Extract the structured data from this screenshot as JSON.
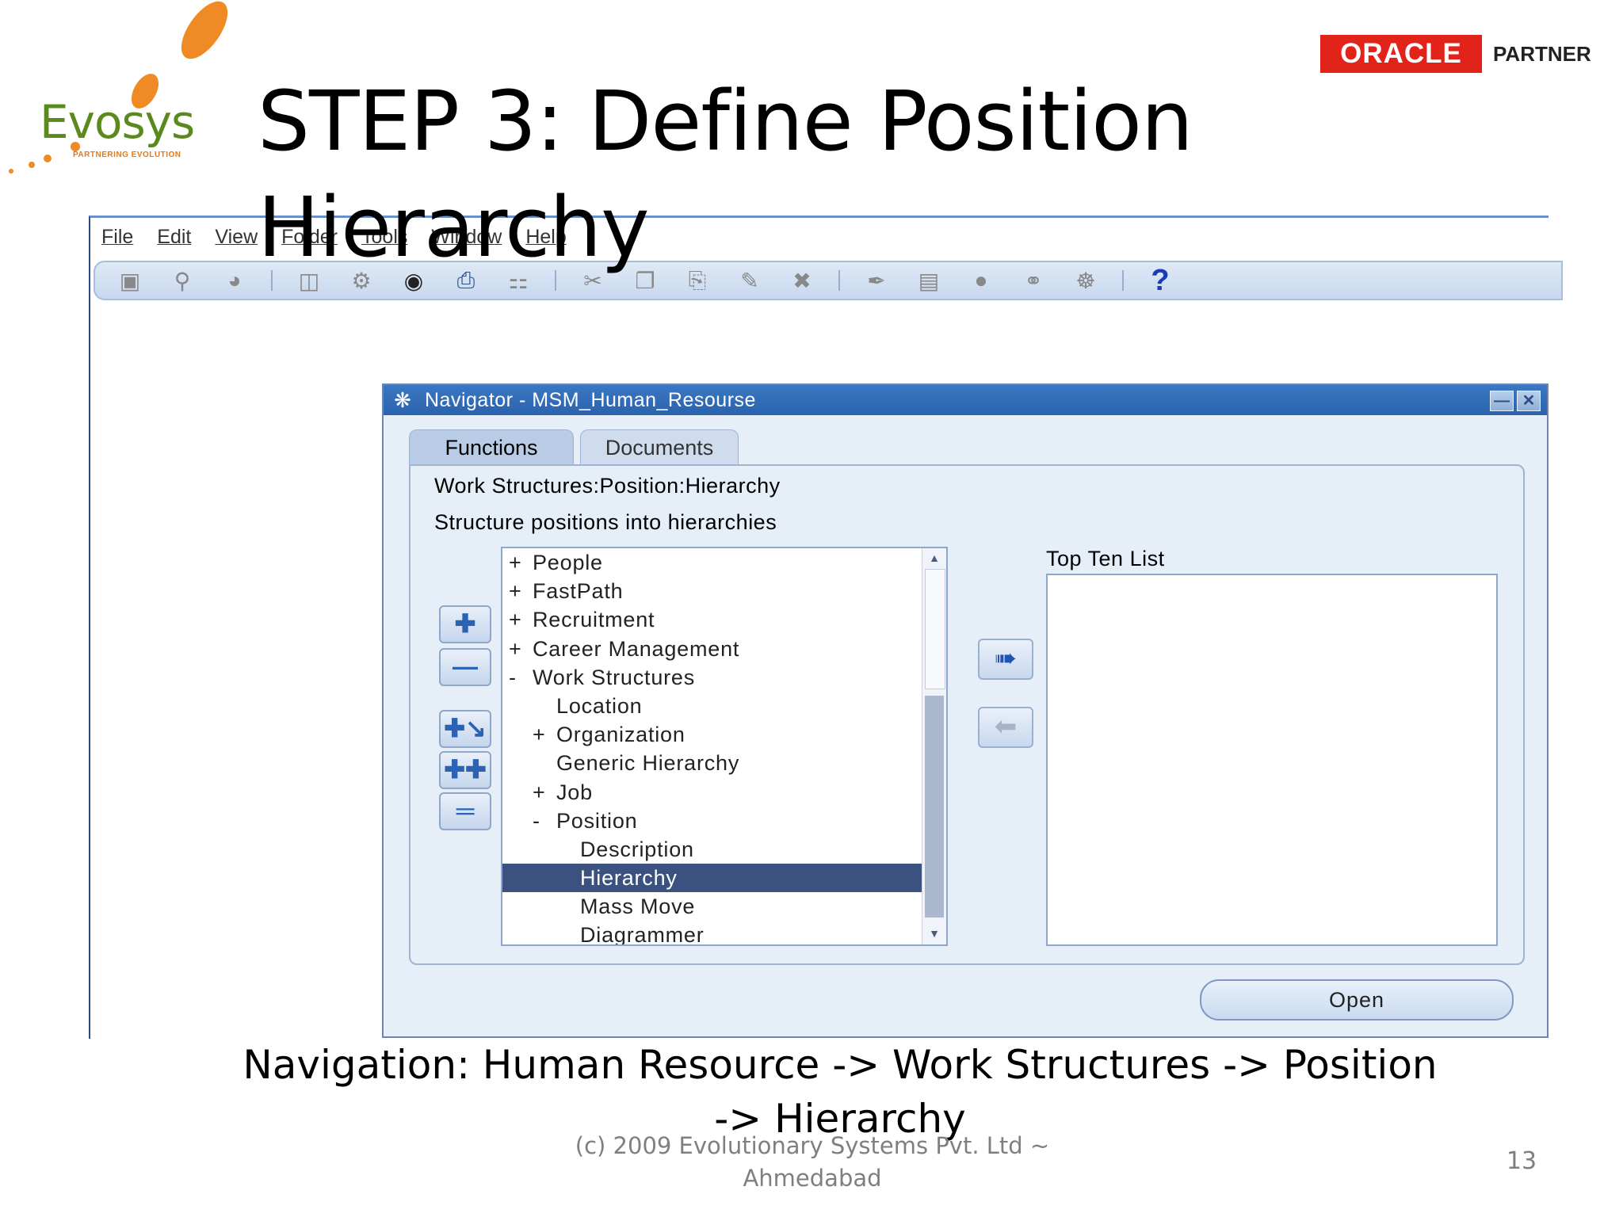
{
  "slide": {
    "title": "STEP 3: Define Position Hierarchy",
    "navigation_caption": "Navigation: Human Resource -> Work Structures -> Position -> Hierarchy",
    "footer": "(c) 2009 Evolutionary Systems Pvt. Ltd ~ Ahmedabad",
    "page_number": "13"
  },
  "logo": {
    "name": "Evosys",
    "tagline": "PARTNERING EVOLUTION"
  },
  "oracle_badge": {
    "brand": "ORACLE",
    "label": "PARTNER",
    "color": "#e2231a"
  },
  "app": {
    "menu": [
      "File",
      "Edit",
      "View",
      "Folder",
      "Tools",
      "Window",
      "Help"
    ],
    "toolbar_icons": [
      "new-record-icon",
      "find-icon",
      "navigator-icon",
      "save-icon",
      "next-step-icon",
      "switch-responsibility-icon",
      "print-icon",
      "close-form-icon",
      "cut-icon",
      "copy-icon",
      "paste-icon",
      "clear-record-icon",
      "delete-record-icon",
      "edit-field-icon",
      "zoom-icon",
      "translations-icon",
      "attachments-icon",
      "folder-tools-icon",
      "help-icon"
    ],
    "help_glyph": "?"
  },
  "navigator": {
    "title": "Navigator - MSM_Human_Resourse",
    "tabs": {
      "functions": "Functions",
      "documents": "Documents"
    },
    "selected_path": "Work Structures:Position:Hierarchy",
    "description": "Structure positions into hierarchies",
    "tree": [
      {
        "prefix": "+",
        "indent": 0,
        "label": "People"
      },
      {
        "prefix": "+",
        "indent": 0,
        "label": "FastPath"
      },
      {
        "prefix": "+",
        "indent": 0,
        "label": "Recruitment"
      },
      {
        "prefix": "+",
        "indent": 0,
        "label": "Career Management"
      },
      {
        "prefix": "-",
        "indent": 0,
        "label": "Work Structures"
      },
      {
        "prefix": "",
        "indent": 1,
        "label": "Location"
      },
      {
        "prefix": "+",
        "indent": 1,
        "label": "Organization"
      },
      {
        "prefix": "",
        "indent": 1,
        "label": "Generic Hierarchy"
      },
      {
        "prefix": "+",
        "indent": 1,
        "label": "Job"
      },
      {
        "prefix": "-",
        "indent": 1,
        "label": "Position"
      },
      {
        "prefix": "",
        "indent": 2,
        "label": "Description"
      },
      {
        "prefix": "",
        "indent": 2,
        "label": "Hierarchy",
        "selected": true
      },
      {
        "prefix": "",
        "indent": 2,
        "label": "Mass Move"
      },
      {
        "prefix": "",
        "indent": 2,
        "label": "Diagrammer"
      }
    ],
    "top_ten_label": "Top Ten List",
    "top_ten_items": [],
    "open_button": "Open",
    "accent_color": "#2a62ad",
    "selection_color": "#3b5281"
  }
}
